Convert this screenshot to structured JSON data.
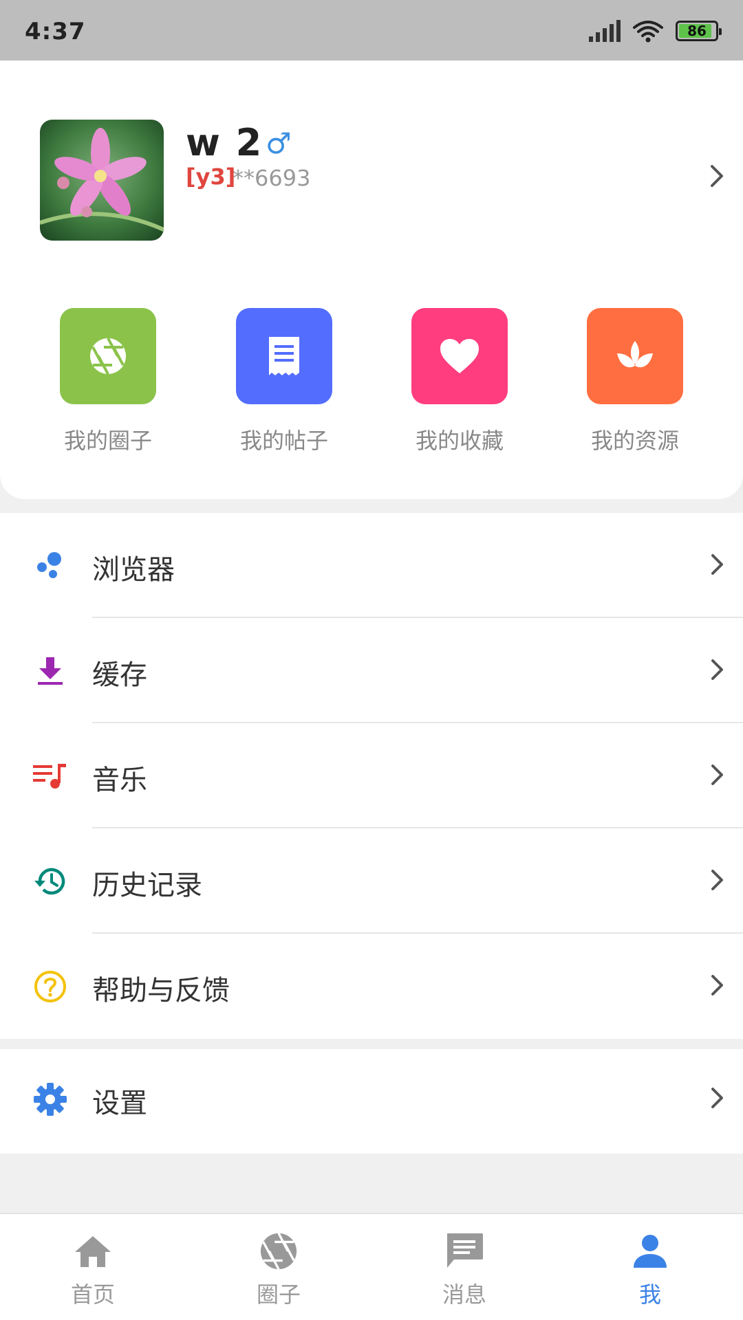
{
  "status_bar": {
    "time": "4:37",
    "battery": "86",
    "icons": [
      "signal-icon",
      "wifi-icon",
      "battery-icon"
    ]
  },
  "profile": {
    "username": "w  2",
    "gender_symbol": "♂",
    "level": "[y3]",
    "user_id": "**6693",
    "avatar_icon": "flower-avatar"
  },
  "quick_actions": [
    {
      "label": "我的圈子",
      "icon": "aperture-icon",
      "color": "#8bc34a"
    },
    {
      "label": "我的帖子",
      "icon": "receipt-icon",
      "color": "#536dfe"
    },
    {
      "label": "我的收藏",
      "icon": "heart-icon",
      "color": "#ff3d7f"
    },
    {
      "label": "我的资源",
      "icon": "lotus-icon",
      "color": "#ff6e40"
    }
  ],
  "menu": [
    {
      "label": "浏览器",
      "icon": "browser-dots-icon",
      "color": "#3b82e6"
    },
    {
      "label": "缓存",
      "icon": "download-icon",
      "color": "#9c27b0"
    },
    {
      "label": "音乐",
      "icon": "playlist-music-icon",
      "color": "#e53935"
    },
    {
      "label": "历史记录",
      "icon": "history-icon",
      "color": "#00897b"
    },
    {
      "label": "帮助与反馈",
      "icon": "help-icon",
      "color": "#f4c20d"
    }
  ],
  "settings": {
    "label": "设置",
    "icon": "gear-icon",
    "color": "#3b82e6"
  },
  "bottom_nav": [
    {
      "label": "首页",
      "icon": "home-icon",
      "active": false
    },
    {
      "label": "圈子",
      "icon": "aperture-icon",
      "active": false
    },
    {
      "label": "消息",
      "icon": "message-icon",
      "active": false
    },
    {
      "label": "我",
      "icon": "person-icon",
      "active": true
    }
  ],
  "colors": {
    "active": "#3b82e6",
    "inactive": "#999999",
    "status_bar": "#bdbdbd"
  }
}
